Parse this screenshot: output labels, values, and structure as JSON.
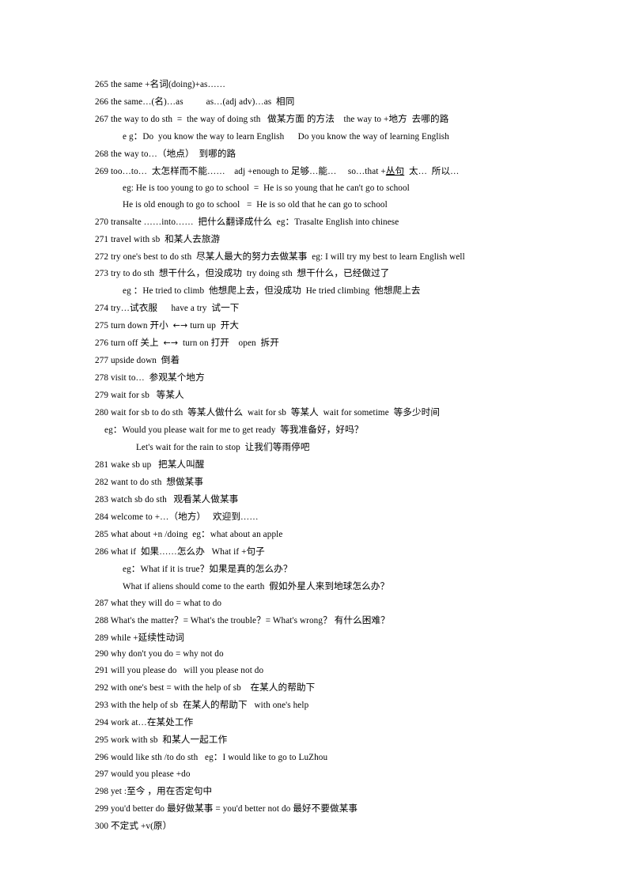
{
  "document": {
    "page_background": "#ffffff",
    "text_color": "#000000",
    "lines": [
      {
        "indent": "ind-0",
        "text": "265 the same +名词(doing)+as……"
      },
      {
        "indent": "ind-0",
        "text": "266 the same…(名)…as          as…(adj adv)…as  相同"
      },
      {
        "indent": "ind-0",
        "text": "267 the way to do sth  =  the way of doing sth   做某方面 的方法    the way to +地方  去哪的路"
      },
      {
        "indent": "ind-1",
        "text": "e g：Do  you know the way to learn English      Do you know the way of learning English"
      },
      {
        "indent": "ind-0",
        "text": "268 the way to…（地点）  到哪的路"
      },
      {
        "indent": "ind-0",
        "text": "269 too…to…  太怎样而不能……    adj +enough to 足够…能…     so…that +丛句  太…  所以…"
      },
      {
        "indent": "ind-1",
        "text": "eg: He is too young to go to school  =  He is so young that he can't go to school"
      },
      {
        "indent": "ind-1",
        "text": "He is old enough to go to school   =  He is so old that he can go to school"
      },
      {
        "indent": "ind-0",
        "text": "270 transalte ……into……  把什么翻译成什么  eg：Trasalte English into chinese"
      },
      {
        "indent": "ind-0",
        "text": "271 travel with sb  和某人去旅游"
      },
      {
        "indent": "ind-0",
        "text": "272 try one's best to do sth  尽某人最大的努力去做某事  eg: I will try my best to learn English well"
      },
      {
        "indent": "ind-0",
        "text": "273 try to do sth  想干什么，但没成功  try doing sth  想干什么，已经做过了"
      },
      {
        "indent": "ind-1",
        "text": "eg ：He tried to climb  他想爬上去，但没成功  He tried climbing  他想爬上去"
      },
      {
        "indent": "ind-0",
        "text": "274 try…试衣服      have a try  试一下"
      },
      {
        "indent": "ind-0",
        "text": "275 turn down 开小  ←→ turn up  开大"
      },
      {
        "indent": "ind-0",
        "text": "276 turn off 关上  ←→  turn on 打开    open  拆开"
      },
      {
        "indent": "ind-0",
        "text": "277 upside down  倒着"
      },
      {
        "indent": "ind-0",
        "text": "278 visit to…  参观某个地方"
      },
      {
        "indent": "ind-0",
        "text": "279 wait for sb   等某人"
      },
      {
        "indent": "ind-0",
        "text": "280 wait for sb to do sth  等某人做什么  wait for sb  等某人  wait for sometime  等多少时间"
      },
      {
        "indent": "ind-xs",
        "text": "eg：Would you please wait for me to get ready  等我准备好，好吗？"
      },
      {
        "indent": "ind-2",
        "text": "Let's wait for the rain to stop  让我们等雨停吧"
      },
      {
        "indent": "ind-0",
        "text": "281 wake sb up   把某人叫醒"
      },
      {
        "indent": "ind-0",
        "text": "282 want to do sth  想做某事"
      },
      {
        "indent": "ind-0",
        "text": "283 watch sb do sth   观看某人做某事"
      },
      {
        "indent": "ind-0",
        "text": "284 welcome to +…（地方）   欢迎到……"
      },
      {
        "indent": "ind-0",
        "text": "285 what about +n /doing  eg：what about an apple"
      },
      {
        "indent": "ind-0",
        "text": "286 what if  如果……怎么办   What if +句子"
      },
      {
        "indent": "ind-1",
        "text": "eg：What if it is true？如果是真的怎么办？"
      },
      {
        "indent": "ind-1",
        "text": "What if aliens should come to the earth  假如外星人来到地球怎么办？"
      },
      {
        "indent": "ind-0",
        "text": "287 what they will do = what to do"
      },
      {
        "indent": "ind-0",
        "text": "288 What's the matter？= What's the trouble？= What's wrong？ 有什么困难？"
      },
      {
        "indent": "ind-0",
        "text": "289 while +延续性动词"
      },
      {
        "indent": "ind-0",
        "text": "290 why don't you do = why not do"
      },
      {
        "indent": "ind-0",
        "text": "291 will you please do   will you please not do"
      },
      {
        "indent": "ind-0",
        "text": "292 with one's best = with the help of sb    在某人的帮助下"
      },
      {
        "indent": "ind-0",
        "text": "293 with the help of sb  在某人的帮助下   with one's help"
      },
      {
        "indent": "ind-0",
        "text": "294 work at…在某处工作"
      },
      {
        "indent": "ind-0",
        "text": "295 work with sb  和某人一起工作"
      },
      {
        "indent": "ind-0",
        "text": "296 would like sth /to do sth   eg：I would like to go to LuZhou"
      },
      {
        "indent": "ind-0",
        "text": "297 would you please +do"
      },
      {
        "indent": "ind-0",
        "text": "298 yet :至今 ，用在否定句中"
      },
      {
        "indent": "ind-0",
        "text": "299 you'd better do 最好做某事 = you'd better not do 最好不要做某事"
      },
      {
        "indent": "ind-0",
        "text": "300 不定式 +v(原）"
      }
    ]
  }
}
